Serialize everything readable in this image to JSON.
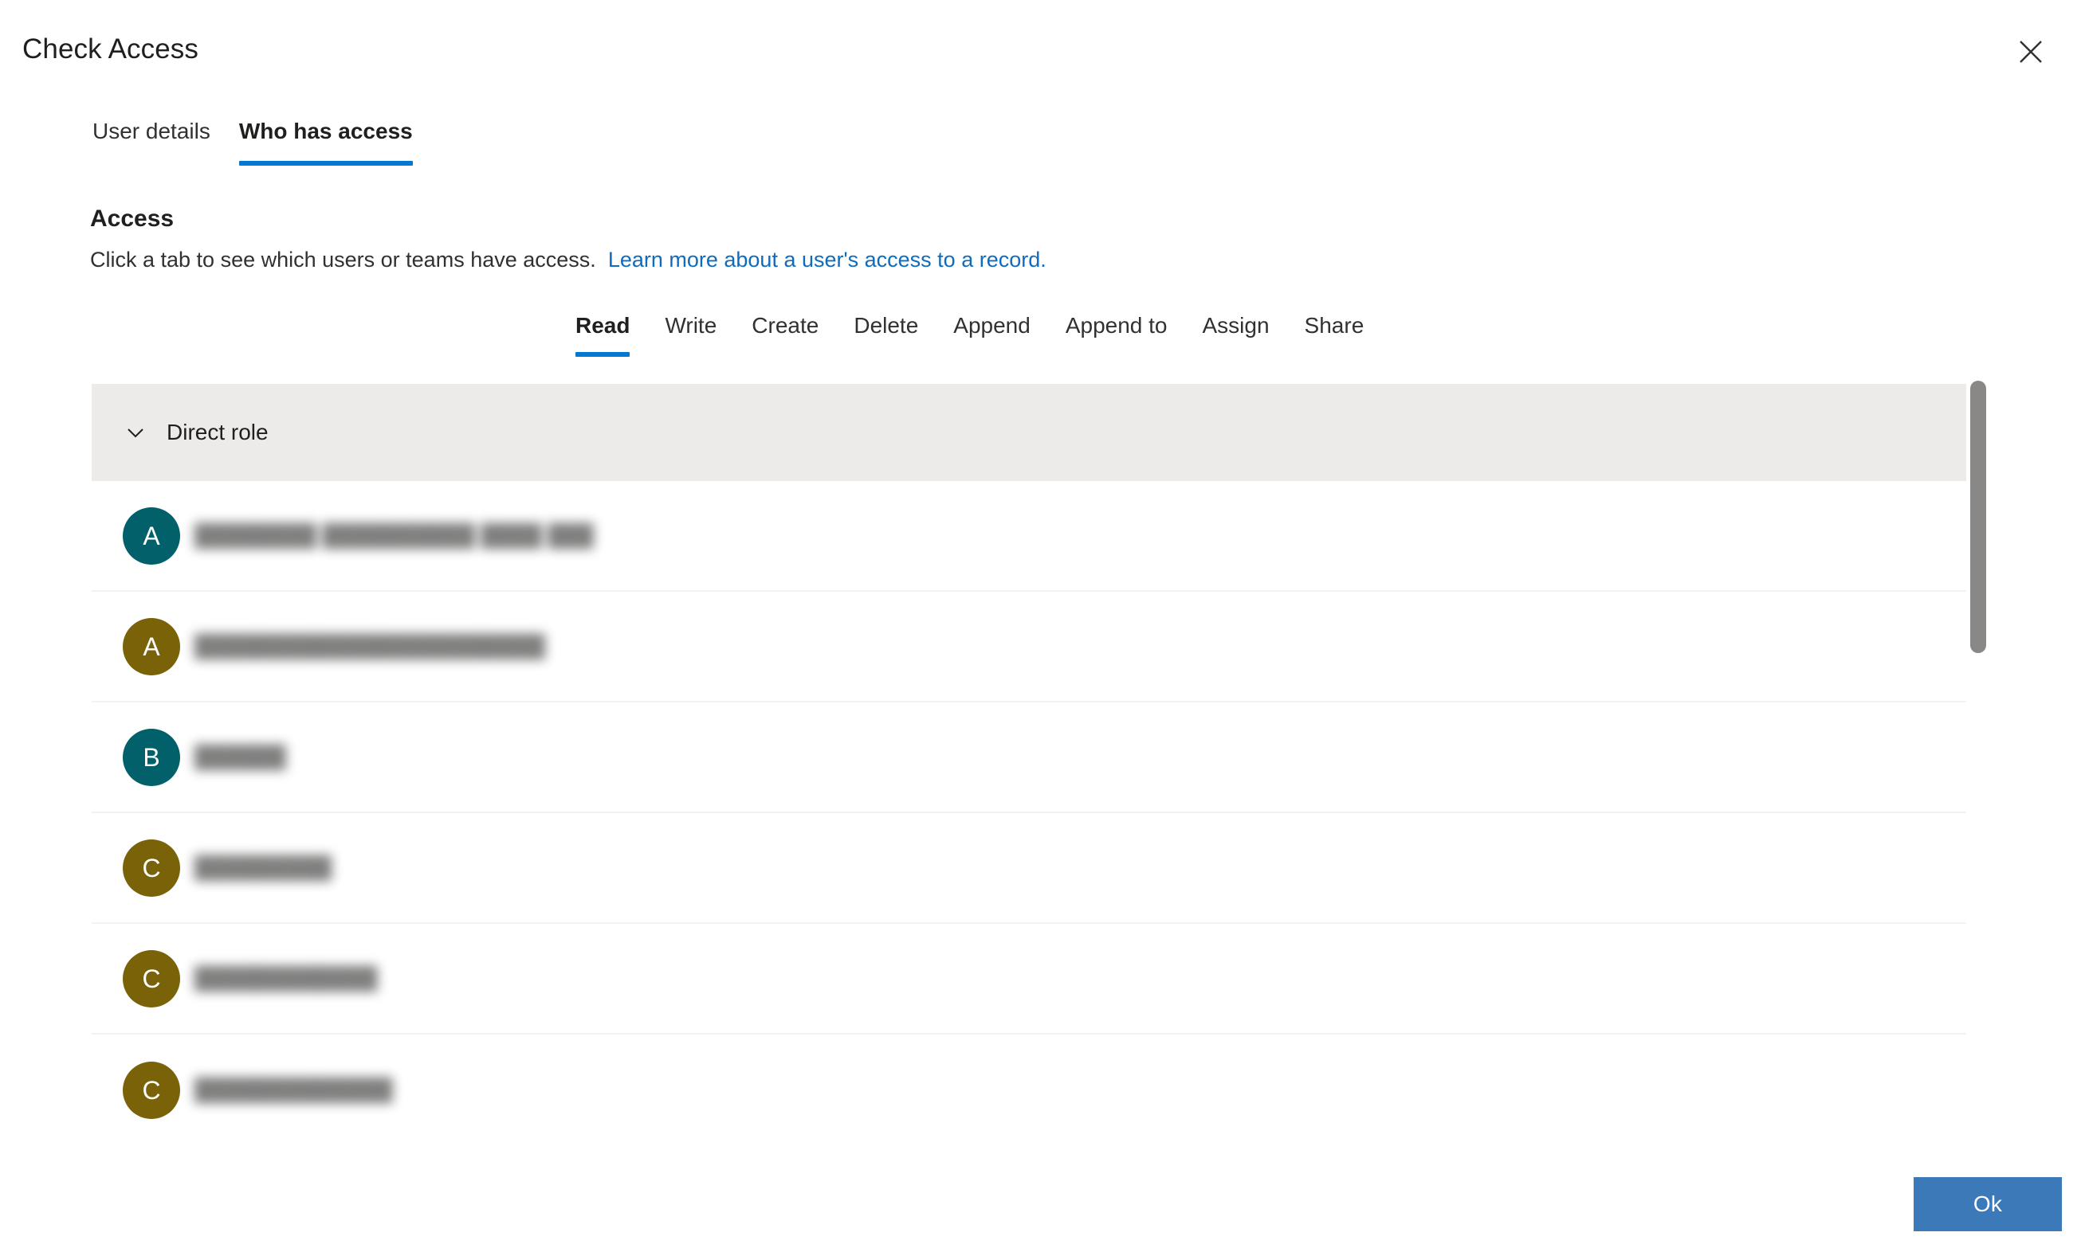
{
  "dialog": {
    "title": "Check Access",
    "close_icon": "close-icon"
  },
  "pivots": [
    {
      "label": "User details",
      "selected": false
    },
    {
      "label": "Who has access",
      "selected": true
    }
  ],
  "access": {
    "heading": "Access",
    "description": "Click a tab to see which users or teams have access.",
    "link_text": "Learn more about a user's access to a record."
  },
  "permission_tabs": [
    {
      "label": "Read",
      "selected": true
    },
    {
      "label": "Write",
      "selected": false
    },
    {
      "label": "Create",
      "selected": false
    },
    {
      "label": "Delete",
      "selected": false
    },
    {
      "label": "Append",
      "selected": false
    },
    {
      "label": "Append to",
      "selected": false
    },
    {
      "label": "Assign",
      "selected": false
    },
    {
      "label": "Share",
      "selected": false
    }
  ],
  "group": {
    "label": "Direct role",
    "expanded": true,
    "chevron_icon": "chevron-down-icon"
  },
  "rows": [
    {
      "initial": "A",
      "avatar_color": "#02606a",
      "name": "████████  ██████████  ████ ███"
    },
    {
      "initial": "A",
      "avatar_color": "#7a6209",
      "name": "███████████████████████"
    },
    {
      "initial": "B",
      "avatar_color": "#02606a",
      "name": "██████"
    },
    {
      "initial": "C",
      "avatar_color": "#7a6209",
      "name": "█████████"
    },
    {
      "initial": "C",
      "avatar_color": "#7a6209",
      "name": "████████████"
    },
    {
      "initial": "C",
      "avatar_color": "#7a6209",
      "name": "█████████████"
    }
  ],
  "footer": {
    "ok_label": "Ok"
  },
  "colors": {
    "accent_blue": "#0078d4",
    "link_blue": "#0f6cbd",
    "button_blue": "#3b79b8",
    "group_header_bg": "#edebe9",
    "row_divider": "#f3f2f1",
    "avatar_teal": "#02606a",
    "avatar_olive": "#7a6209",
    "scrollbar_thumb": "#8a8886"
  },
  "scrollbar": {
    "orientation": "vertical",
    "thumb_position": "top"
  }
}
